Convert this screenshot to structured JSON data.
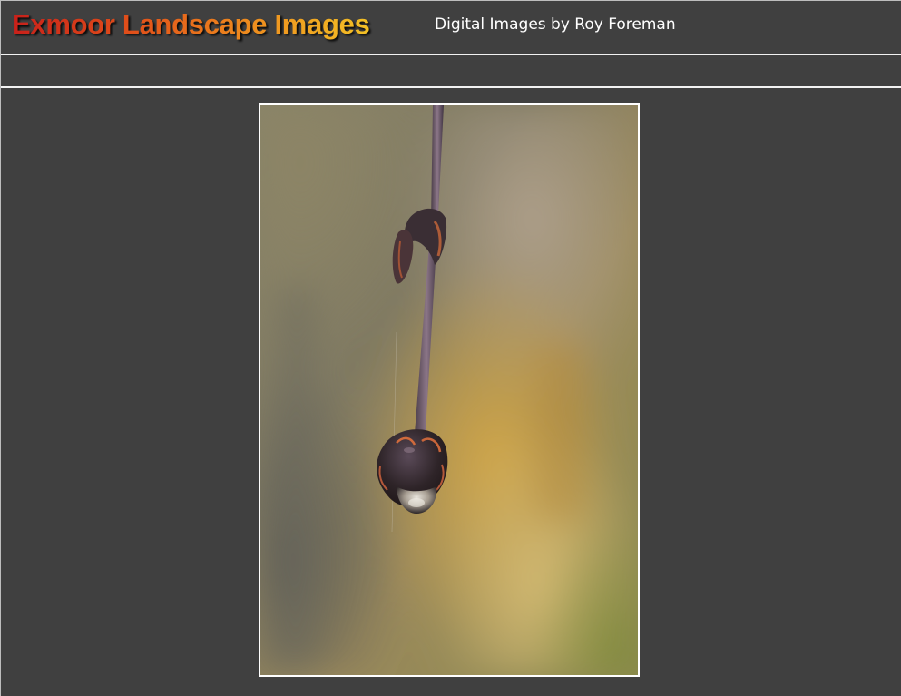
{
  "header": {
    "title": "Exmoor Landscape Images",
    "subtitle": "Digital Images by Roy Foreman"
  },
  "colors": {
    "background": "#404040",
    "divider": "#f2f2f2",
    "title_gradient_start": "#c8201a",
    "title_gradient_end": "#f3c125",
    "subtitle": "#ffffff"
  },
  "photo": {
    "subject": "water droplet on bud at tip of twig"
  }
}
